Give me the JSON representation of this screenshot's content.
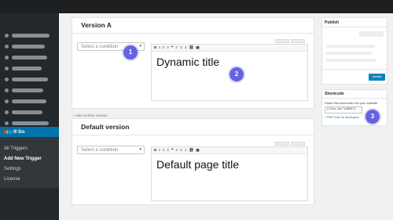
{
  "sidebar": {
    "active_item": "If-So",
    "brand_colors": [
      "#e74c3c",
      "#f39c12",
      "#2ecc71",
      "#3498db"
    ],
    "submenu": [
      "All Triggers",
      "Add New Trigger",
      "Settings",
      "License"
    ]
  },
  "version_a": {
    "title": "Version A",
    "select_placeholder": "Select a condition",
    "select_arrow": "▾",
    "editor_text": "Dynamic title",
    "toolbar": [
      "B",
      "I",
      "≡",
      "≡",
      "❝",
      "≡",
      "≡",
      "≡",
      "⛓",
      "▦"
    ]
  },
  "add_version_link": "+ Add another version",
  "default_version": {
    "title": "Default version",
    "select_placeholder": "Select a condition",
    "select_arrow": "▾",
    "editor_text": "Default page title",
    "toolbar": [
      "B",
      "I",
      "≡",
      "≡",
      "❝",
      "≡",
      "≡",
      "≡",
      "⛓",
      "▦"
    ]
  },
  "publish": {
    "title": "Publish",
    "update_label": "Update"
  },
  "shortcode": {
    "title": "Shortcode",
    "description": "Paste this shortcode into your website",
    "code": "[ifso id=\"13803\"]",
    "help_link": "+ PHP Code for developers"
  },
  "badges": [
    "1",
    "2",
    "3"
  ],
  "colors": {
    "accent": "#0073aa",
    "badge": "#6663e0",
    "sidebar": "#23282d"
  }
}
